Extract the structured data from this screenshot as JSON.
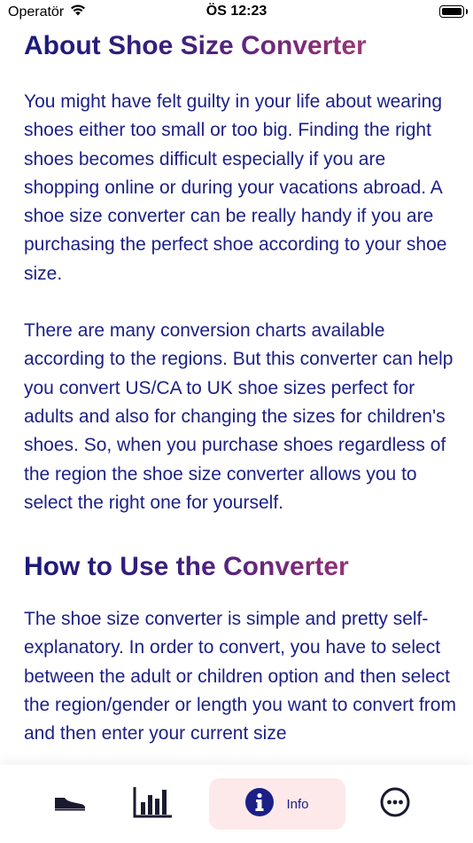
{
  "status_bar": {
    "carrier": "Operatör",
    "time": "ÖS 12:23"
  },
  "sections": [
    {
      "heading": "About Shoe Size Converter",
      "paragraphs": [
        "You might have felt guilty in your life about wearing shoes either too small or too big. Finding the right shoes becomes difficult especially if you are shopping online or during your vacations abroad. A shoe size converter can be really handy if you are purchasing the perfect shoe according to your shoe size.",
        "There are many conversion charts available according to the regions. But this converter can help you convert US/CA to UK shoe sizes perfect for adults and also for changing the sizes for children's shoes. So, when you purchase shoes regardless of the region the shoe size converter allows you to select the right one for yourself."
      ]
    },
    {
      "heading": "How to Use the Converter",
      "paragraphs": [
        "The shoe size converter is simple and pretty self-explanatory. In order to convert, you have to select between the adult or children option and then select the region/gender or length you want to convert from and then enter your current size"
      ]
    }
  ],
  "tab_bar": {
    "tabs": [
      {
        "icon": "shoe-icon",
        "label": ""
      },
      {
        "icon": "bar-chart-icon",
        "label": ""
      },
      {
        "icon": "info-icon",
        "label": "Info",
        "selected": true
      },
      {
        "icon": "more-icon",
        "label": ""
      }
    ]
  },
  "colors": {
    "text": "#1b1f86",
    "heading_gradient_start": "#1a1a7a",
    "heading_gradient_end": "#c05a80",
    "selected_tab_bg": "#fde9ea"
  }
}
